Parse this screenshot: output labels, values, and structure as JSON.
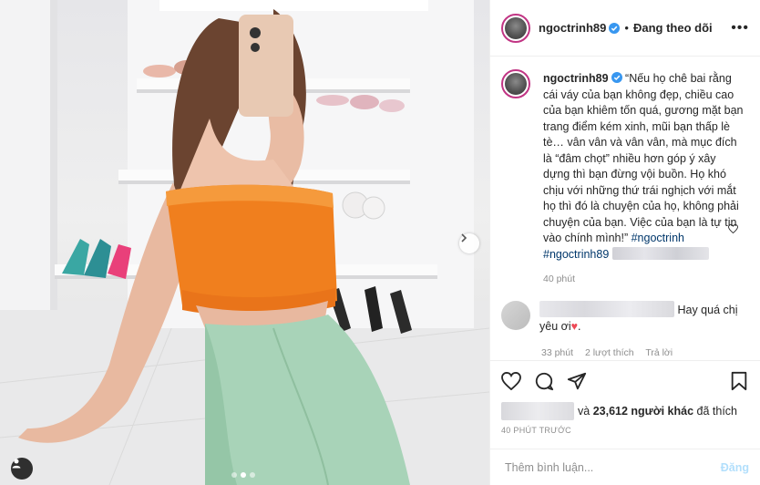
{
  "header": {
    "username": "ngoctrinh89",
    "separator": "•",
    "follow_label": "Đang theo dõi",
    "more_icon": "more-icon"
  },
  "caption": {
    "username": "ngoctrinh89",
    "text": "“Nếu họ chê bai rằng cái váy của bạn không đẹp, chiều cao của bạn khiêm tốn quá, gương mặt bạn trang điểm kém xinh, mũi bạn thấp lè tè… vân vân và vân vân, mà mục đích là “đâm chọt” nhiều hơn góp ý xây dựng thì bạn đừng vội buồn. Họ khó chịu với những thứ trái nghịch với mắt họ thì đó là chuyện của họ, không phải chuyện của bạn. Việc của bạn là tự tin vào chính mình!”",
    "hashtag1": "#ngoctrinh",
    "hashtag2": "#ngoctrinh89",
    "time": "40 phút"
  },
  "comment": {
    "text": "Hay quá chị yêu ơi",
    "emoji": "♥",
    "emoji_suffix": ".",
    "time": "33 phút",
    "likes": "2 lượt thích",
    "reply": "Trả lời"
  },
  "likes": {
    "connector": "và",
    "count_text": "23,612 người khác",
    "suffix": "đã thích"
  },
  "posted_ago": "40 PHÚT TRƯỚC",
  "add_comment": {
    "placeholder": "Thêm bình luận...",
    "post_label": "Đăng"
  },
  "carousel": {
    "slides": 3,
    "active_index": 1
  },
  "colors": {
    "accent": "#0095f6",
    "post_disabled": "#b2dffc",
    "muted": "#8e8e8e",
    "heart": "#ed4956",
    "text": "#262626"
  }
}
